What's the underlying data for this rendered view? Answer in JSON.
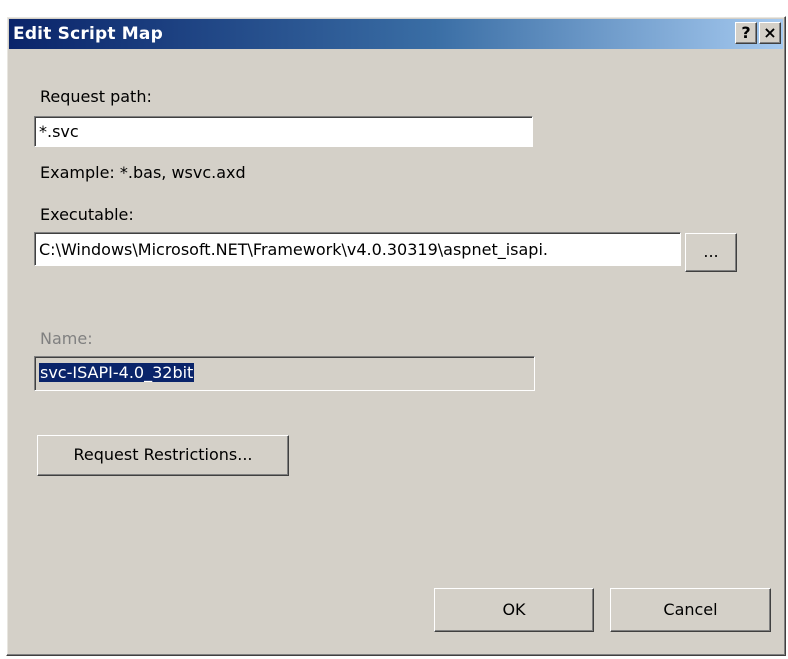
{
  "dialog": {
    "title": "Edit Script Map",
    "help_glyph": "?",
    "close_glyph": "×"
  },
  "request_path": {
    "label": "Request path:",
    "value": "*.svc",
    "example": "Example: *.bas, wsvc.axd"
  },
  "executable": {
    "label": "Executable:",
    "value": "C:\\Windows\\Microsoft.NET\\Framework\\v4.0.30319\\aspnet_isapi.",
    "browse_label": "..."
  },
  "name": {
    "label": "Name:",
    "value": "svc-ISAPI-4.0_32bit"
  },
  "buttons": {
    "request_restrictions": "Request Restrictions...",
    "ok": "OK",
    "cancel": "Cancel"
  },
  "colors": {
    "titlebar_start": "#0a246a",
    "titlebar_end": "#a6caf0",
    "dialog_face": "#d4d0c8",
    "selection": "#0a246a"
  },
  "icons": {
    "help": "question-mark",
    "close": "x-mark"
  }
}
